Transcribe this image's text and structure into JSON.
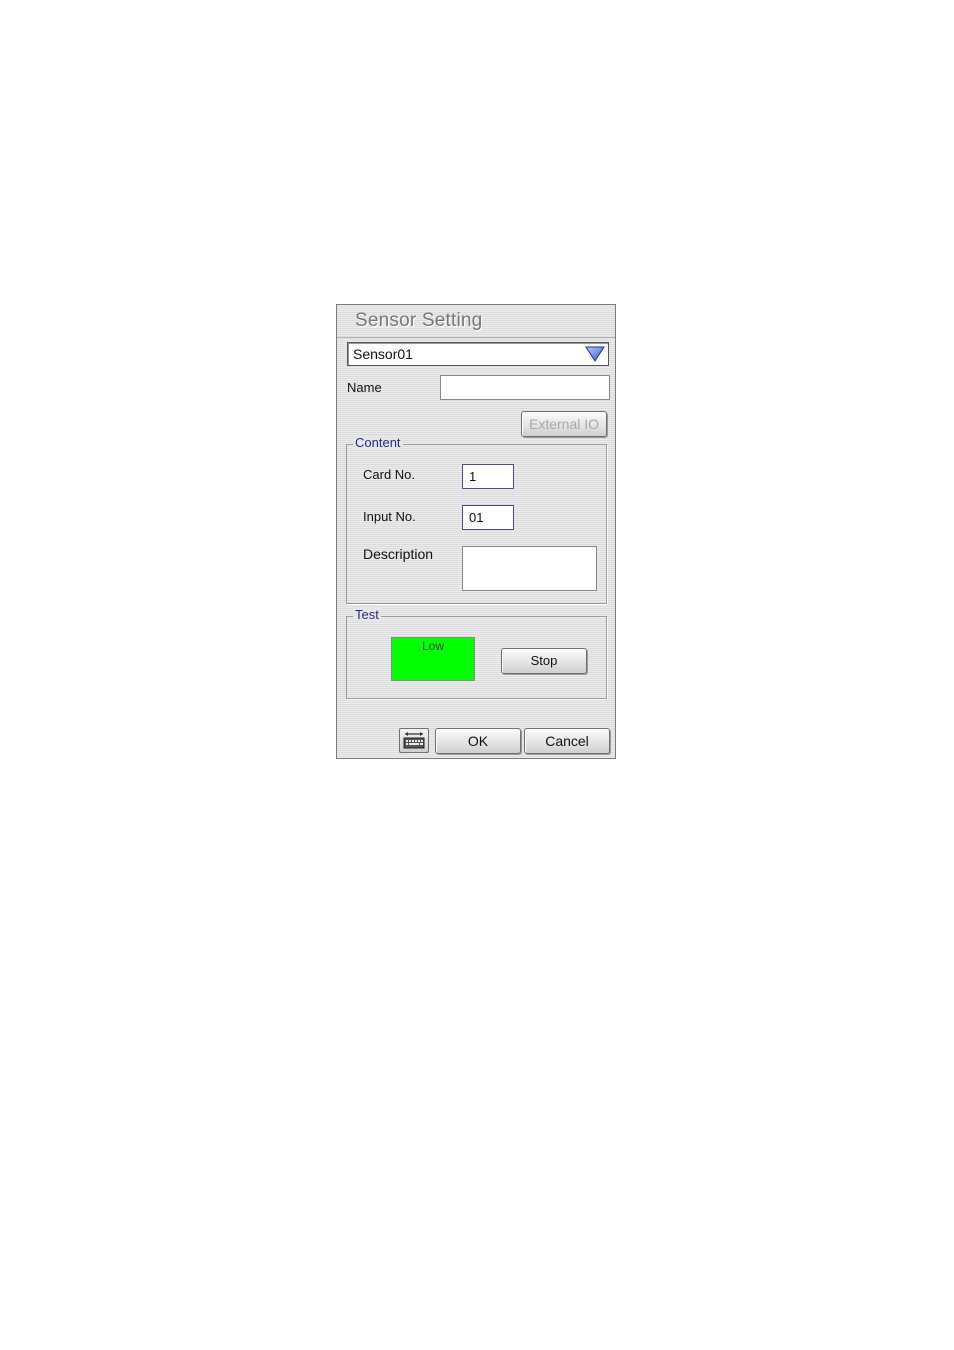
{
  "dialog": {
    "title": "Sensor Setting",
    "sensor_select": {
      "value": "Sensor01"
    },
    "name": {
      "label": "Name",
      "value": ""
    },
    "external_io_label": "External IO",
    "content": {
      "legend": "Content",
      "card_no": {
        "label": "Card No.",
        "value": "1"
      },
      "input_no": {
        "label": "Input No.",
        "value": "01"
      },
      "description": {
        "label": "Description",
        "value": ""
      }
    },
    "test": {
      "legend": "Test",
      "indicator_label": "Low",
      "stop_label": "Stop"
    },
    "ok_label": "OK",
    "cancel_label": "Cancel"
  },
  "colors": {
    "indicator_low": "#00ff00",
    "legend_text": "#2a2a88",
    "dropdown_arrow": "#3a5fd0"
  },
  "icons": {
    "dropdown": "triangle-down-icon",
    "keyboard": "keyboard-icon"
  }
}
